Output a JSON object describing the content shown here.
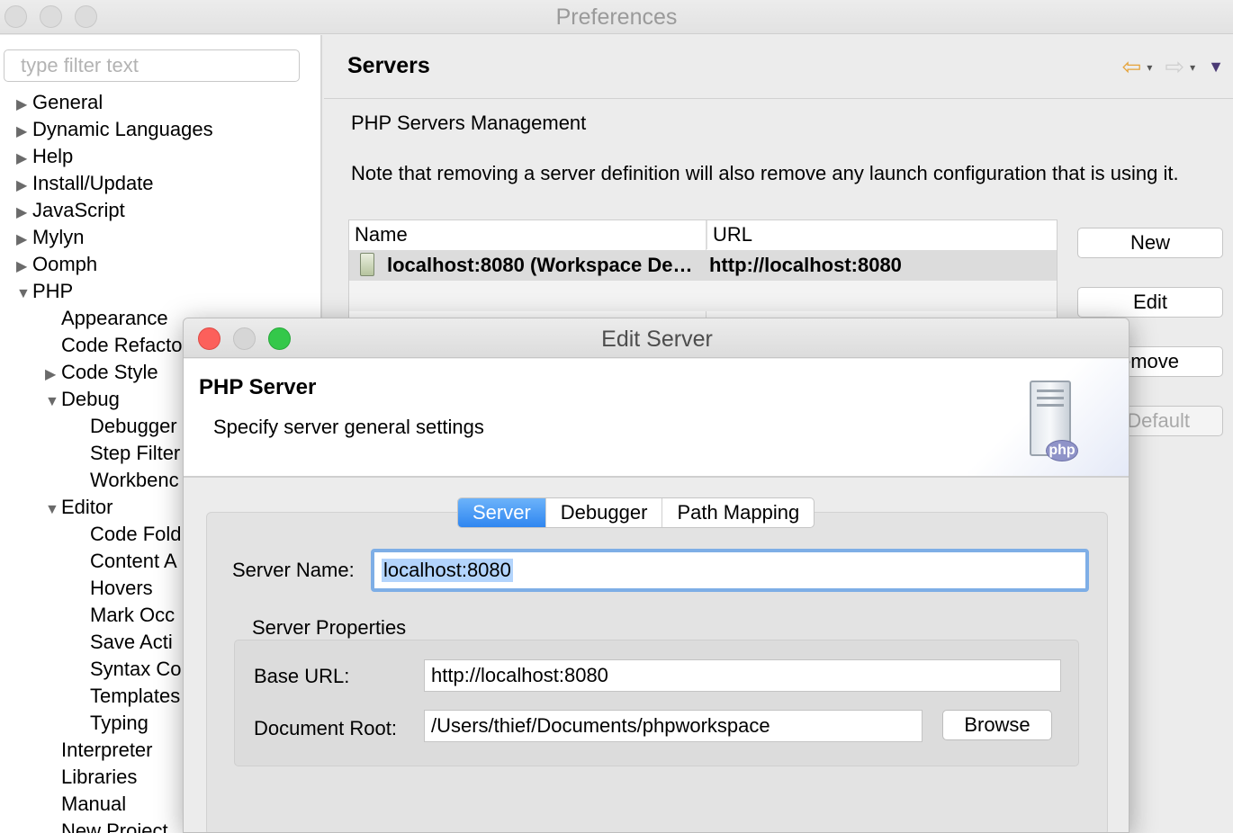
{
  "window": {
    "title": "Preferences"
  },
  "sidebar": {
    "filter_placeholder": "type filter text",
    "items": [
      {
        "label": "General",
        "expander": "▶"
      },
      {
        "label": "Dynamic Languages",
        "expander": "▶"
      },
      {
        "label": "Help",
        "expander": "▶"
      },
      {
        "label": "Install/Update",
        "expander": "▶"
      },
      {
        "label": "JavaScript",
        "expander": "▶"
      },
      {
        "label": "Mylyn",
        "expander": "▶"
      },
      {
        "label": "Oomph",
        "expander": "▶"
      },
      {
        "label": "PHP",
        "expander": "▼"
      },
      {
        "label": "Appearance",
        "expander": ""
      },
      {
        "label": "Code Refacto",
        "expander": ""
      },
      {
        "label": "Code Style",
        "expander": "▶"
      },
      {
        "label": "Debug",
        "expander": "▼"
      },
      {
        "label": "Debugger",
        "expander": ""
      },
      {
        "label": "Step Filter",
        "expander": ""
      },
      {
        "label": "Workbenc",
        "expander": ""
      },
      {
        "label": "Editor",
        "expander": "▼"
      },
      {
        "label": "Code Fold",
        "expander": ""
      },
      {
        "label": "Content A",
        "expander": ""
      },
      {
        "label": "Hovers",
        "expander": ""
      },
      {
        "label": "Mark Occ",
        "expander": ""
      },
      {
        "label": "Save Acti",
        "expander": ""
      },
      {
        "label": "Syntax Co",
        "expander": ""
      },
      {
        "label": "Templates",
        "expander": ""
      },
      {
        "label": "Typing",
        "expander": ""
      },
      {
        "label": "Interpreter",
        "expander": ""
      },
      {
        "label": "Libraries",
        "expander": ""
      },
      {
        "label": "Manual",
        "expander": ""
      },
      {
        "label": "New Project",
        "expander": ""
      }
    ]
  },
  "page": {
    "title": "Servers",
    "nav": {
      "back_icon": "⇦",
      "forward_icon": "⇨",
      "dropdown_icon": "▾",
      "menu_icon": "▼"
    },
    "heading": "PHP Servers Management",
    "note": "Note that removing a server definition will also remove any launch configuration that is using it.",
    "table": {
      "columns": [
        "Name",
        "URL"
      ],
      "rows": [
        {
          "name": "localhost:8080 (Workspace De…",
          "url": "http://localhost:8080"
        }
      ]
    },
    "buttons": {
      "new": "New",
      "edit": "Edit",
      "remove": "emove",
      "default": "Default"
    }
  },
  "dialog": {
    "title": "Edit Server",
    "banner_title": "PHP Server",
    "banner_desc": "Specify server general settings",
    "badge": "php",
    "tabs": [
      "Server",
      "Debugger",
      "Path Mapping"
    ],
    "active_tab": "Server",
    "server_name_label": "Server Name:",
    "server_name_value": "localhost:8080",
    "properties_label": "Server Properties",
    "base_url_label": "Base URL:",
    "base_url_value": "http://localhost:8080",
    "doc_root_label": "Document Root:",
    "doc_root_value": "/Users/thief/Documents/phpworkspace",
    "browse_label": "Browse"
  }
}
